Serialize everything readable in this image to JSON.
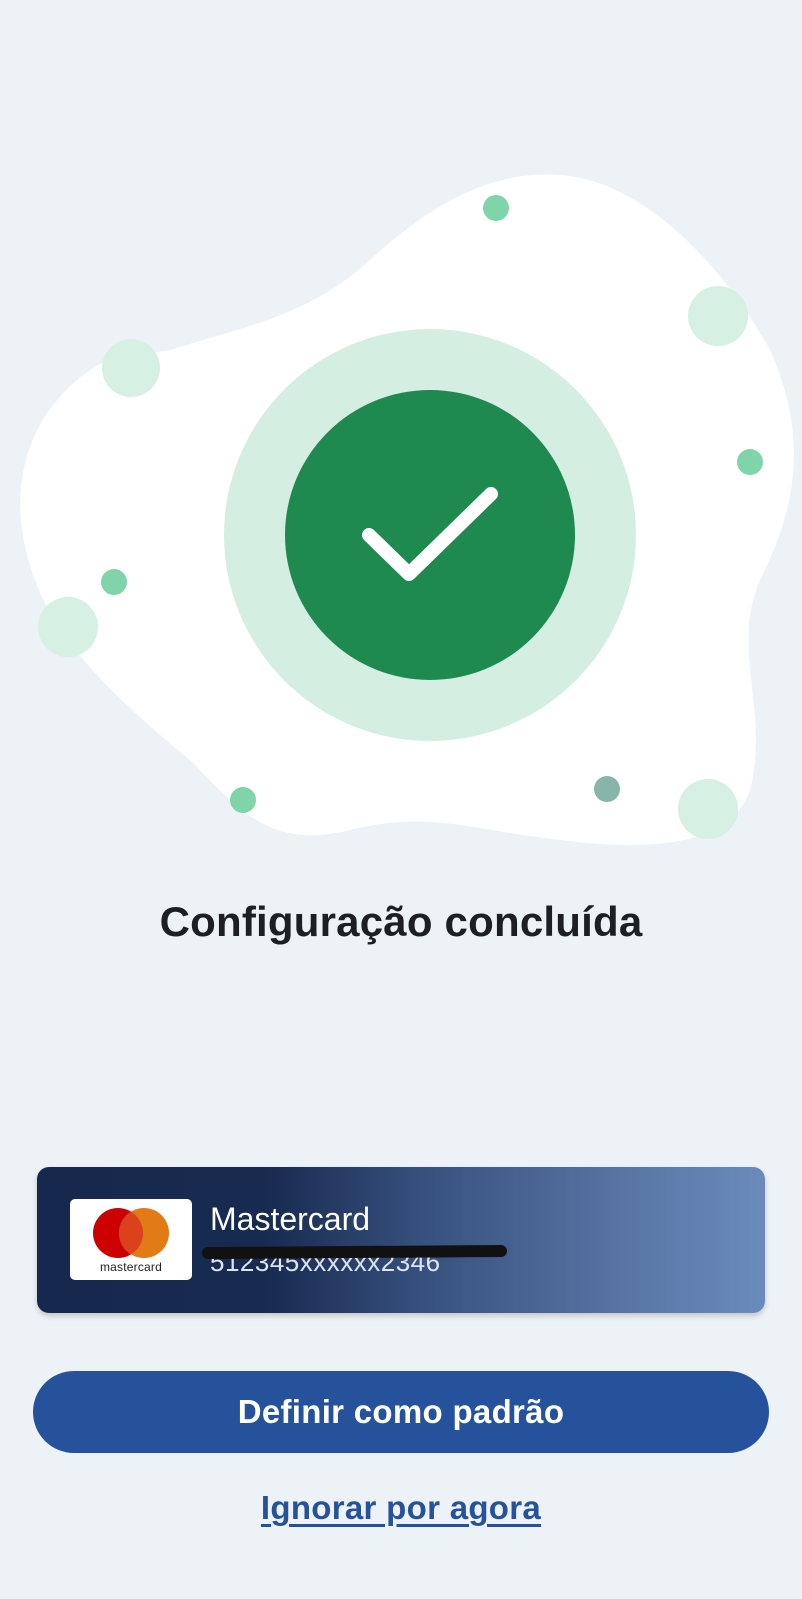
{
  "success": {
    "title": "Configuração concluída",
    "icon": "checkmark-icon"
  },
  "card": {
    "brand_label": "Mastercard",
    "logo_text": "mastercard",
    "number_masked": "512345xxxxxx2346"
  },
  "actions": {
    "primary_label": "Definir como padrão",
    "secondary_label": "Ignorar por agora"
  },
  "colors": {
    "background": "#edf2f6",
    "success_green": "#1e8a4f",
    "success_halo": "#d4efe2",
    "primary_blue": "#25529a",
    "card_dark": "#16284d",
    "card_light": "#6b8bbd"
  }
}
